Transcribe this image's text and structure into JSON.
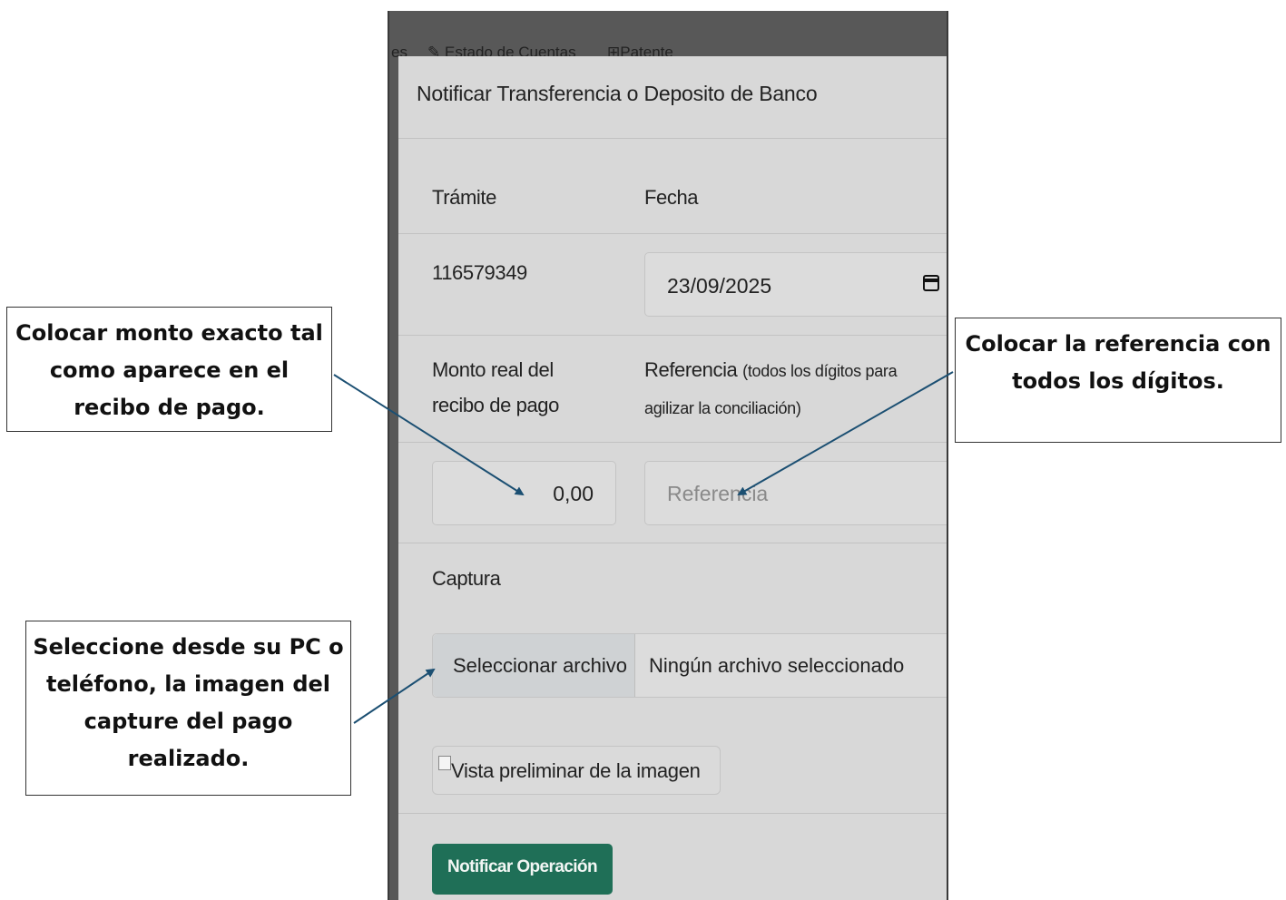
{
  "background_nav": {
    "left_fragment": "es",
    "item1": "Estado de Cuentas",
    "item2": "Patente"
  },
  "modal": {
    "title": "Notificar Transferencia o Deposito de Banco",
    "tramite_label": "Trámite",
    "tramite_value": "116579349",
    "fecha_label": "Fecha",
    "fecha_value": "23/09/2025",
    "monto_label_line1": "Monto real del",
    "monto_label_line2": "recibo de pago",
    "referencia_label": "Referencia",
    "referencia_hint_line1": "(todos los dígitos para",
    "referencia_hint_line2": "agilizar la conciliación)",
    "monto_value": "0,00",
    "referencia_placeholder": "Referencia",
    "captura_label": "Captura",
    "file_button_label": "Seleccionar archivo",
    "file_status": "Ningún archivo seleccionado",
    "preview_alt": "Vista preliminar de la imagen",
    "submit_label": "Notificar Operación"
  },
  "callouts": {
    "monto": [
      "Colocar monto exacto tal",
      "como aparece en el",
      "recibo de pago."
    ],
    "referencia": [
      "Colocar la referencia con",
      "todos los dígitos."
    ],
    "captura": [
      "Seleccione desde su PC o",
      "teléfono, la imagen del",
      "capture del pago",
      "realizado."
    ]
  },
  "colors": {
    "primary_button": "#1f6f57",
    "arrow": "#1b4f72",
    "modal_background": "#d8d8d8"
  }
}
